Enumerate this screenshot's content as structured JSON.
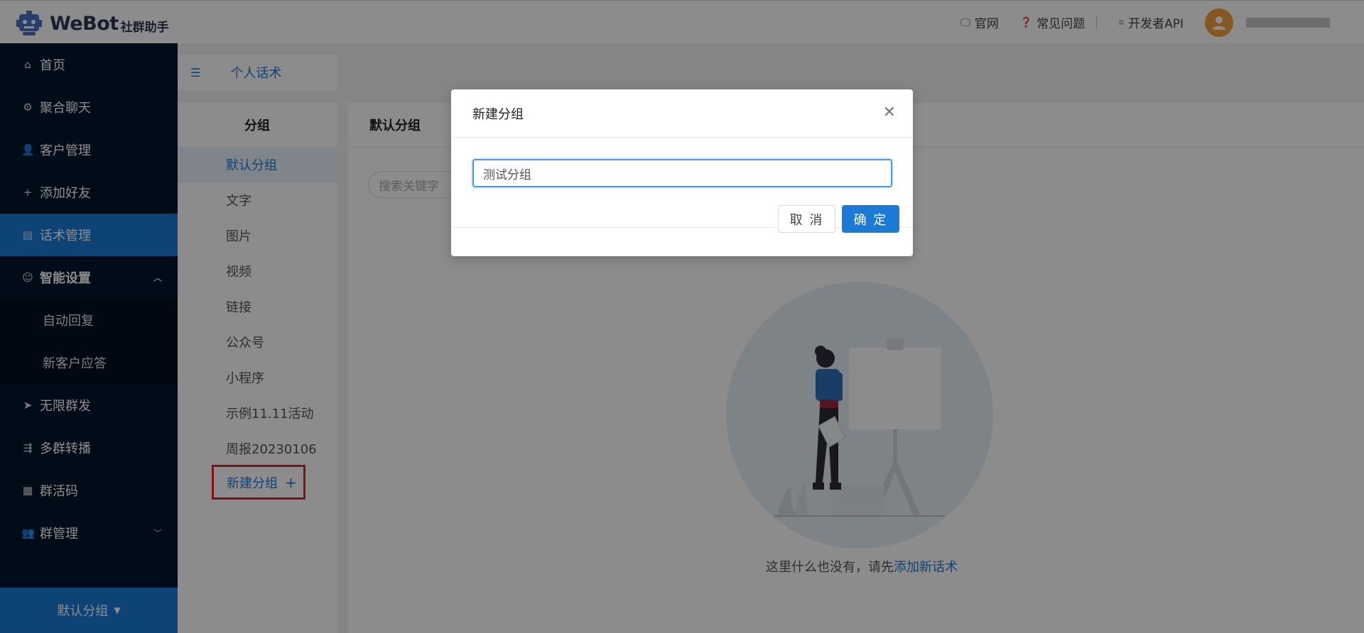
{
  "header": {
    "brand": "WeBot",
    "brand_sub": "社群助手",
    "links": {
      "website": "官网",
      "faq": "常见问题",
      "dev_api": "开发者API"
    }
  },
  "sidebar": {
    "items": {
      "home": "首页",
      "chat": "聚合聊天",
      "customers": "客户管理",
      "add_friend": "添加好友",
      "scripts": "话术管理",
      "smart": "智能设置",
      "auto_reply": "自动回复",
      "new_customer": "新客户应答",
      "broadcast": "无限群发",
      "forward": "多群转播",
      "qrcode": "群活码",
      "group_mgmt": "群管理"
    },
    "bottom": "默认分组"
  },
  "tab": {
    "label": "个人话术"
  },
  "groups": {
    "title": "分组",
    "items": [
      "默认分组",
      "文字",
      "图片",
      "视频",
      "链接",
      "公众号",
      "小程序",
      "示例11.11活动",
      "周报20230106"
    ],
    "new_group": "新建分组"
  },
  "main": {
    "title": "默认分组",
    "search_placeholder": "搜索关键字",
    "empty_text": "这里什么也没有，请先",
    "empty_link": "添加新话术"
  },
  "modal": {
    "title": "新建分组",
    "input_value": "测试分组",
    "cancel": "取 消",
    "confirm": "确 定"
  },
  "colors": {
    "primary": "#1b7ad6",
    "sidebar_bg": "#03172f",
    "highlight_border": "#e8232d",
    "avatar": "#f3a13d"
  }
}
